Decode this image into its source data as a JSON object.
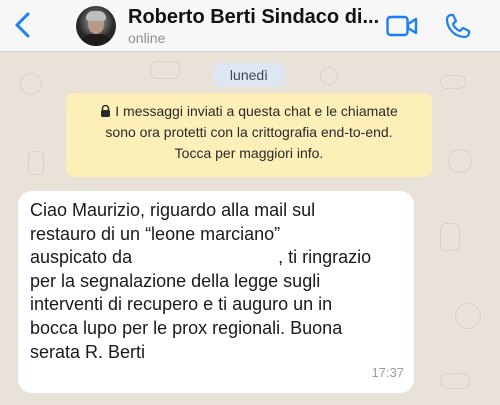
{
  "header": {
    "contact_name": "Roberto Berti Sindaco di...",
    "status": "online",
    "back_icon": "chevron-left-icon",
    "video_icon": "video-camera-icon",
    "call_icon": "phone-icon",
    "accent_color": "#1a7ef5"
  },
  "chat": {
    "date_chip": "lunedì",
    "encryption_notice": {
      "icon": "lock-icon",
      "lines": [
        "I messaggi inviati a questa chat e le chiamate",
        "sono ora protetti con la crittografia end-to-end.",
        "Tocca per maggiori info."
      ]
    },
    "message": {
      "lines": [
        "Ciao Maurizio, riguardo alla mail sul",
        "restauro di un “leone marciano”",
        "auspicato da",
        ", ti ringrazio",
        "per la segnalazione della legge sugli",
        "interventi di recupero e ti auguro un in",
        "bocca lupo per le prox regionali. Buona",
        "serata R. Berti"
      ],
      "time": "17:37"
    }
  }
}
